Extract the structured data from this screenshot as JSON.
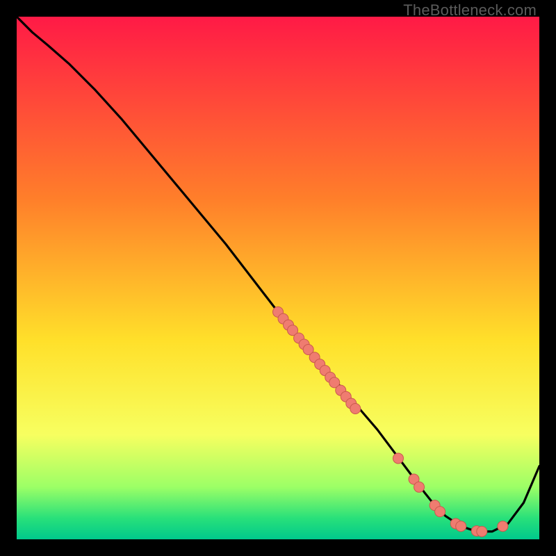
{
  "watermark": "TheBottleneck.com",
  "colors": {
    "bg_black": "#000000",
    "curve": "#000000",
    "dot_fill": "#ef7c70",
    "dot_stroke": "#c9594d",
    "grad_top": "#ff1a46",
    "grad_mid1": "#ff7f2a",
    "grad_mid2": "#ffe02a",
    "grad_low": "#f7ff60",
    "grad_green1": "#9cff66",
    "grad_green2": "#28e07a",
    "grad_green3": "#00c98c"
  },
  "chart_data": {
    "type": "line",
    "title": "",
    "xlabel": "",
    "ylabel": "",
    "xlim": [
      0,
      100
    ],
    "ylim": [
      0,
      100
    ],
    "series": [
      {
        "name": "curve",
        "x": [
          0,
          3,
          6,
          10,
          15,
          20,
          25,
          30,
          35,
          40,
          45,
          50,
          52,
          55,
          58,
          60,
          63,
          66,
          69,
          72,
          75,
          78,
          80,
          82,
          85,
          88,
          91,
          94,
          97,
          100
        ],
        "y": [
          100,
          97,
          94.5,
          91,
          86,
          80.5,
          74.5,
          68.5,
          62.5,
          56.5,
          50,
          43.5,
          41,
          37.5,
          34,
          31.5,
          28,
          24.5,
          21,
          17,
          13,
          9,
          6.5,
          4.5,
          2.5,
          1.5,
          1.5,
          3,
          7,
          14
        ]
      }
    ],
    "points": [
      {
        "x": 50,
        "y": 43.5
      },
      {
        "x": 51,
        "y": 42.2
      },
      {
        "x": 52,
        "y": 41.0
      },
      {
        "x": 52.8,
        "y": 40.0
      },
      {
        "x": 54,
        "y": 38.5
      },
      {
        "x": 55,
        "y": 37.3
      },
      {
        "x": 55.8,
        "y": 36.3
      },
      {
        "x": 57,
        "y": 34.8
      },
      {
        "x": 58,
        "y": 33.5
      },
      {
        "x": 59,
        "y": 32.3
      },
      {
        "x": 60,
        "y": 31.0
      },
      {
        "x": 60.8,
        "y": 30.0
      },
      {
        "x": 62,
        "y": 28.5
      },
      {
        "x": 63,
        "y": 27.3
      },
      {
        "x": 64,
        "y": 26.0
      },
      {
        "x": 64.8,
        "y": 25.0
      },
      {
        "x": 73,
        "y": 15.5
      },
      {
        "x": 76,
        "y": 11.5
      },
      {
        "x": 77,
        "y": 10.0
      },
      {
        "x": 80,
        "y": 6.5
      },
      {
        "x": 81,
        "y": 5.3
      },
      {
        "x": 84,
        "y": 3.0
      },
      {
        "x": 85,
        "y": 2.5
      },
      {
        "x": 88,
        "y": 1.6
      },
      {
        "x": 89,
        "y": 1.5
      },
      {
        "x": 93,
        "y": 2.5
      }
    ]
  }
}
